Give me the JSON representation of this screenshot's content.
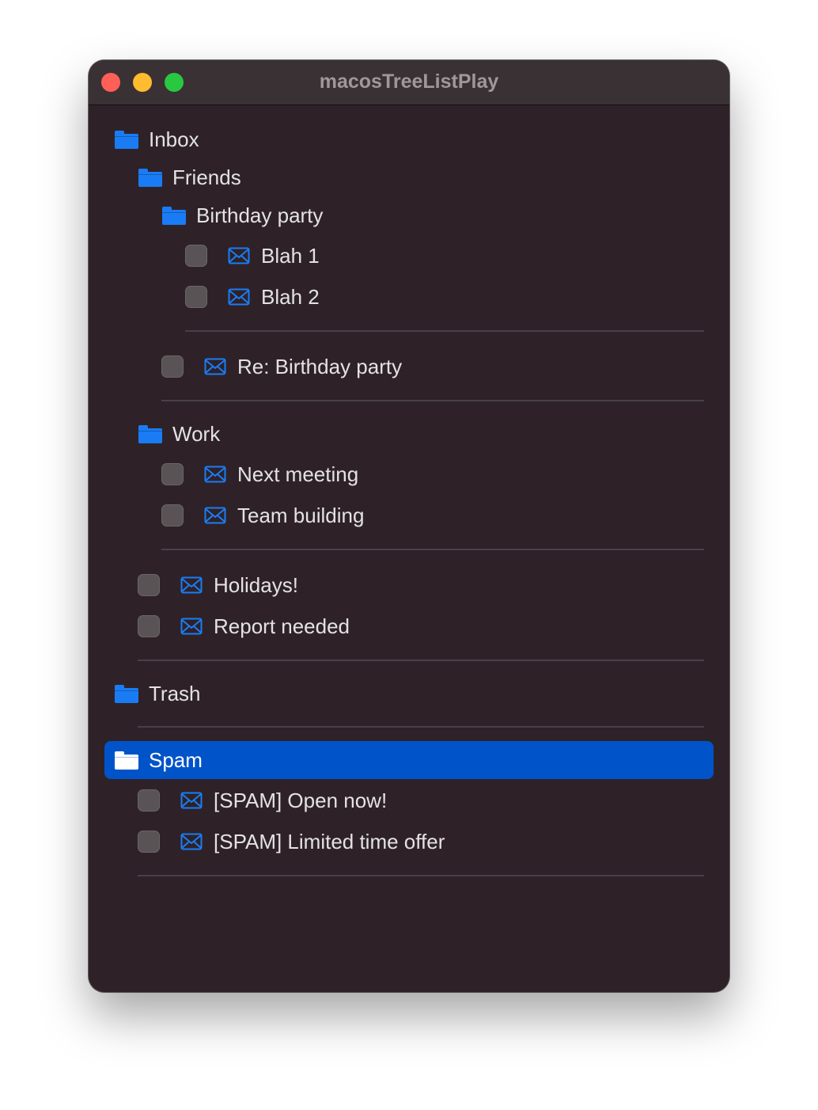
{
  "window": {
    "title": "macosTreeListPlay"
  },
  "colors": {
    "accent": "#1a7cf5",
    "selection": "#0053c9",
    "background": "#2e2228"
  },
  "tree": {
    "inbox": "Inbox",
    "friends": "Friends",
    "birthday_party": "Birthday party",
    "blah1": "Blah 1",
    "blah2": "Blah 2",
    "re_birthday": "Re: Birthday party",
    "work": "Work",
    "next_meeting": "Next meeting",
    "team_building": "Team building",
    "holidays": "Holidays!",
    "report_needed": "Report needed",
    "trash": "Trash",
    "spam": "Spam",
    "spam_open": "[SPAM] Open now!",
    "spam_limited": "[SPAM] Limited time offer"
  },
  "icons": {
    "folder": "folder-icon",
    "message": "envelope-icon",
    "checkbox_state": "unchecked"
  },
  "selection": {
    "selected_item": "Spam"
  }
}
